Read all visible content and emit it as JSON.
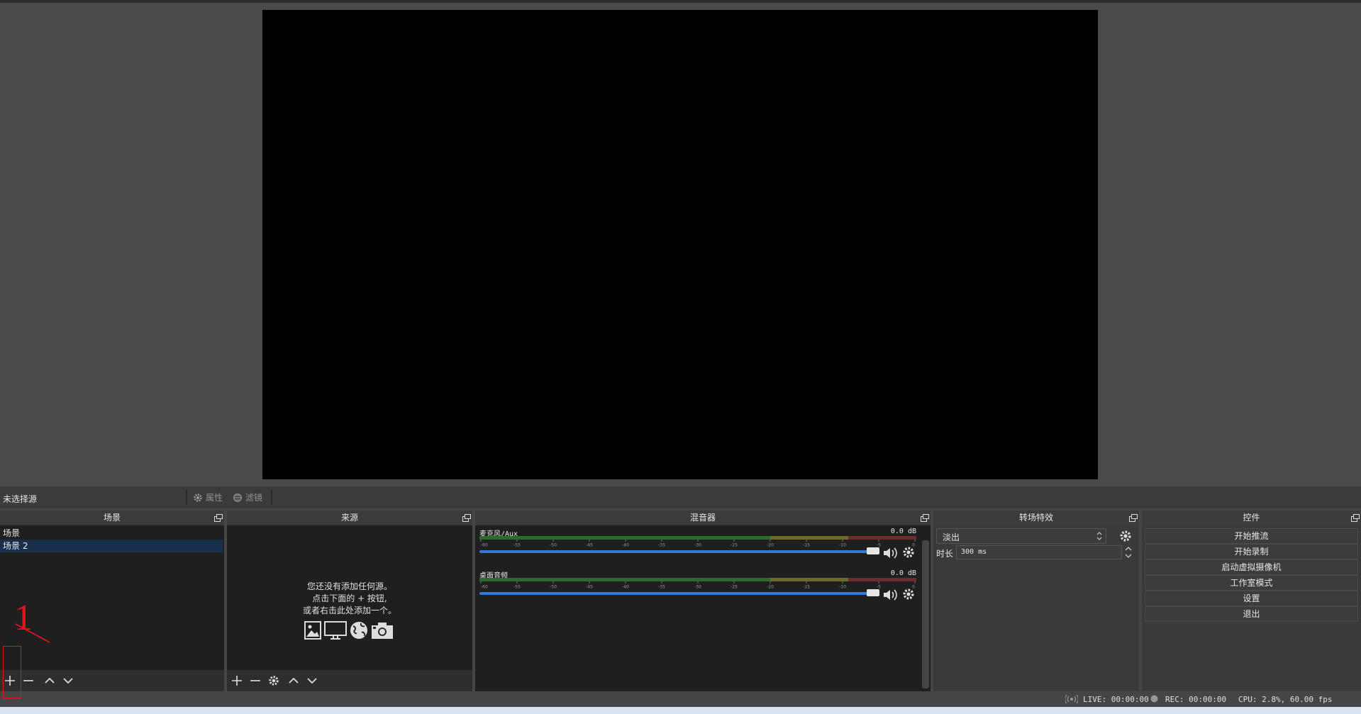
{
  "context_bar": {
    "no_source": "未选择源",
    "properties": "属性",
    "filters": "滤镜"
  },
  "scenes": {
    "title": "场景",
    "items": [
      "场景",
      "场景 2"
    ],
    "selected_index": 1
  },
  "sources": {
    "title": "来源",
    "empty_line1": "您还没有添加任何源。",
    "empty_line2": "点击下面的 + 按钮,",
    "empty_line3": "或者右击此处添加一个。"
  },
  "mixer": {
    "title": "混音器",
    "channels": [
      {
        "name": "麦克风/Aux",
        "db": "0.0 dB"
      },
      {
        "name": "桌面音频",
        "db": "0.0 dB"
      }
    ],
    "ticks": [
      "-60",
      "-55",
      "-50",
      "-45",
      "-40",
      "-35",
      "-30",
      "-25",
      "-20",
      "-15",
      "-10",
      "-5",
      "0"
    ]
  },
  "transitions": {
    "title": "转场特效",
    "selected": "淡出",
    "duration_label": "时长",
    "duration_value": "300 ms"
  },
  "controls": {
    "title": "控件",
    "buttons": [
      "开始推流",
      "开始录制",
      "启动虚拟摄像机",
      "工作室模式",
      "设置",
      "退出"
    ]
  },
  "status": {
    "live": "LIVE: 00:00:00",
    "rec": "REC: 00:00:00",
    "cpu": "CPU: 2.8%, 60.00 fps"
  },
  "annotation": {
    "number": "1"
  },
  "colors": {
    "annotation": "#e0141b",
    "selection": "#19304d",
    "slider": "#2f7bd6"
  }
}
